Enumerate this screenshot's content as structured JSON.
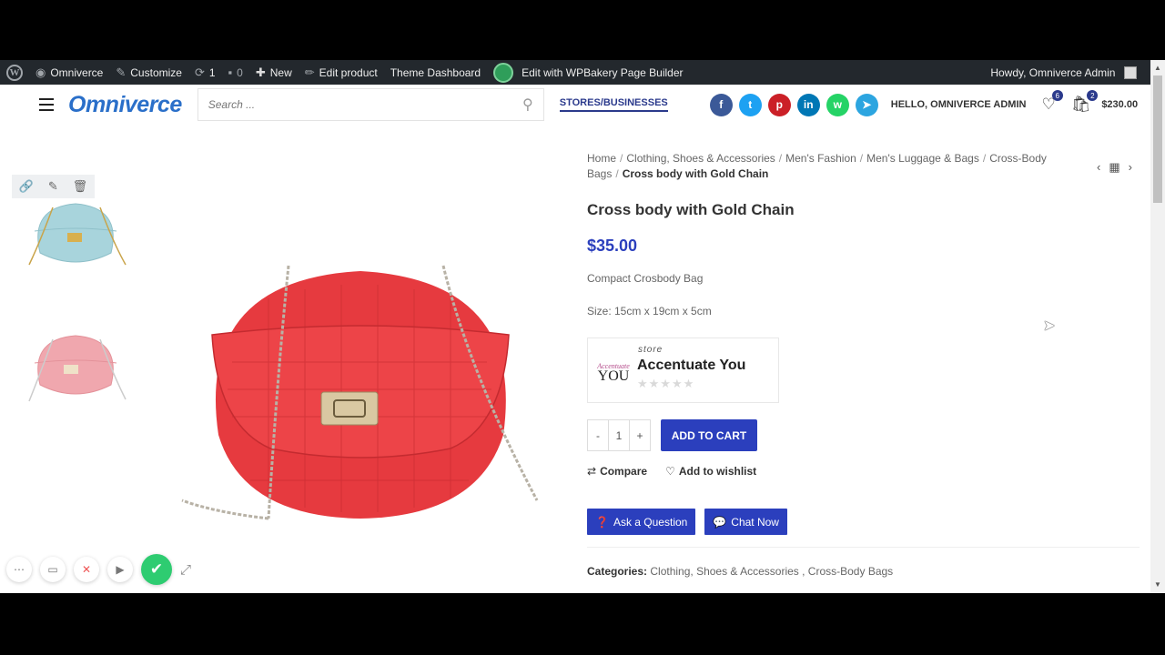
{
  "admin_bar": {
    "items": [
      {
        "icon": "wordpress-logo-icon",
        "label": ""
      },
      {
        "icon": "dashboard-icon",
        "label": "Omniverce"
      },
      {
        "icon": "brush-icon",
        "label": "Customize"
      },
      {
        "icon": "updates-icon",
        "label": "1"
      },
      {
        "icon": "comment-icon",
        "label": "0"
      },
      {
        "icon": "plus-icon",
        "label": "New"
      },
      {
        "icon": "pencil-icon",
        "label": "Edit product"
      },
      {
        "icon": "",
        "label": "Theme Dashboard"
      },
      {
        "icon": "wpbakery-icon",
        "label": "Edit with WPBakery Page Builder"
      }
    ],
    "howdy": "Howdy, Omniverce Admin"
  },
  "header": {
    "logo": "Omniverce",
    "search_placeholder": "Search ...",
    "stores_link": "STORES/BUSINESSES",
    "socials": [
      {
        "name": "facebook",
        "glyph": "f",
        "color": "#3b5998"
      },
      {
        "name": "twitter",
        "glyph": "t",
        "color": "#1da1f2"
      },
      {
        "name": "pinterest",
        "glyph": "p",
        "color": "#cb2027"
      },
      {
        "name": "linkedin",
        "glyph": "in",
        "color": "#0077b5"
      },
      {
        "name": "whatsapp",
        "glyph": "w",
        "color": "#25d366"
      },
      {
        "name": "telegram",
        "glyph": "➤",
        "color": "#2ca5e0"
      }
    ],
    "hello": "HELLO, OMNIVERCE ADMIN",
    "wishlist_count": "6",
    "cart_count": "2",
    "cart_total": "$230.00"
  },
  "product": {
    "breadcrumb": [
      "Home",
      "Clothing, Shoes & Accessories",
      "Men's Fashion",
      "Men's Luggage & Bags",
      "Cross-Body Bags"
    ],
    "breadcrumb_current": "Cross body with Gold Chain",
    "title": "Cross body with Gold Chain",
    "price": "$35.00",
    "description": "Compact  Crosbody Bag",
    "size": "Size: 15cm  x 19cm x 5cm",
    "store": {
      "tag": "store",
      "name": "Accentuate You",
      "logo_script": "Accentuate",
      "logo_text": "YOU",
      "rating": 0
    },
    "quantity": "1",
    "qty_minus": "-",
    "qty_plus": "+",
    "add_to_cart": "ADD TO CART",
    "compare": "Compare",
    "wishlist": "Add to wishlist",
    "ask_question": "Ask a Question",
    "chat_now": "Chat Now",
    "categories_label": "Categories:",
    "categories": "Clothing, Shoes & Accessories , Cross-Body Bags"
  },
  "colors": {
    "accent": "#2b3fbd",
    "bag_main": "#e63a3f",
    "bag_blue": "#a8d4dc",
    "bag_pink": "#f0a7ae"
  }
}
